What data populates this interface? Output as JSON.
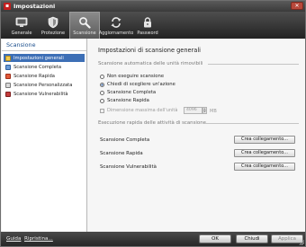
{
  "window": {
    "title": "Impostazioni",
    "close_label": "✕"
  },
  "toolbar": {
    "items": [
      {
        "label": "Generale",
        "icon": "monitor-icon",
        "active": false
      },
      {
        "label": "Protezione",
        "icon": "shield-icon",
        "active": false
      },
      {
        "label": "Scansione",
        "icon": "magnifier-icon",
        "active": true
      },
      {
        "label": "Aggiornamento",
        "icon": "refresh-icon",
        "active": false
      },
      {
        "label": "Password",
        "icon": "lock-icon",
        "active": false
      }
    ]
  },
  "sidebar": {
    "title": "Scansione",
    "items": [
      {
        "label": "Impostazioni generali",
        "icon": "settings-icon",
        "selected": true
      },
      {
        "label": "Scansione Completa",
        "icon": "full-scan-icon",
        "selected": false
      },
      {
        "label": "Scansione Rapida",
        "icon": "quick-scan-icon",
        "selected": false
      },
      {
        "label": "Scansione Personalizzata",
        "icon": "custom-scan-icon",
        "selected": false
      },
      {
        "label": "Scansione Vulnerabilità",
        "icon": "vulnerability-scan-icon",
        "selected": false
      }
    ]
  },
  "main": {
    "heading": "Impostazioni di scansione generali",
    "removable": {
      "section_title": "Scansione automatica delle unità rimovibili",
      "options": [
        {
          "label": "Non eseguire scansione",
          "checked": false
        },
        {
          "label": "Chiedi di scegliere un'azione",
          "checked": true
        },
        {
          "label": "Scansione Completa",
          "checked": false
        },
        {
          "label": "Scansione Rapida",
          "checked": false
        }
      ],
      "max_size_label": "Dimensione massima dell'unità",
      "max_size_value": "4096",
      "max_size_unit": "MB"
    },
    "quick_exec": {
      "section_title": "Esecuzione rapida delle attività di scansione",
      "rows": [
        {
          "label": "Scansione Completa",
          "button": "Crea collegamento..."
        },
        {
          "label": "Scansione Rapida",
          "button": "Crea collegamento..."
        },
        {
          "label": "Scansione Vulnerabilità",
          "button": "Crea collegamento..."
        }
      ]
    }
  },
  "footer": {
    "help": "Guida",
    "restore": "Ripristina...",
    "ok": "OK",
    "close": "Chiudi",
    "apply": "Applica"
  },
  "colors": {
    "selection": "#3d6fb6",
    "sidebar_title": "#1c4f8d",
    "toolbar_dark": "#232323"
  }
}
